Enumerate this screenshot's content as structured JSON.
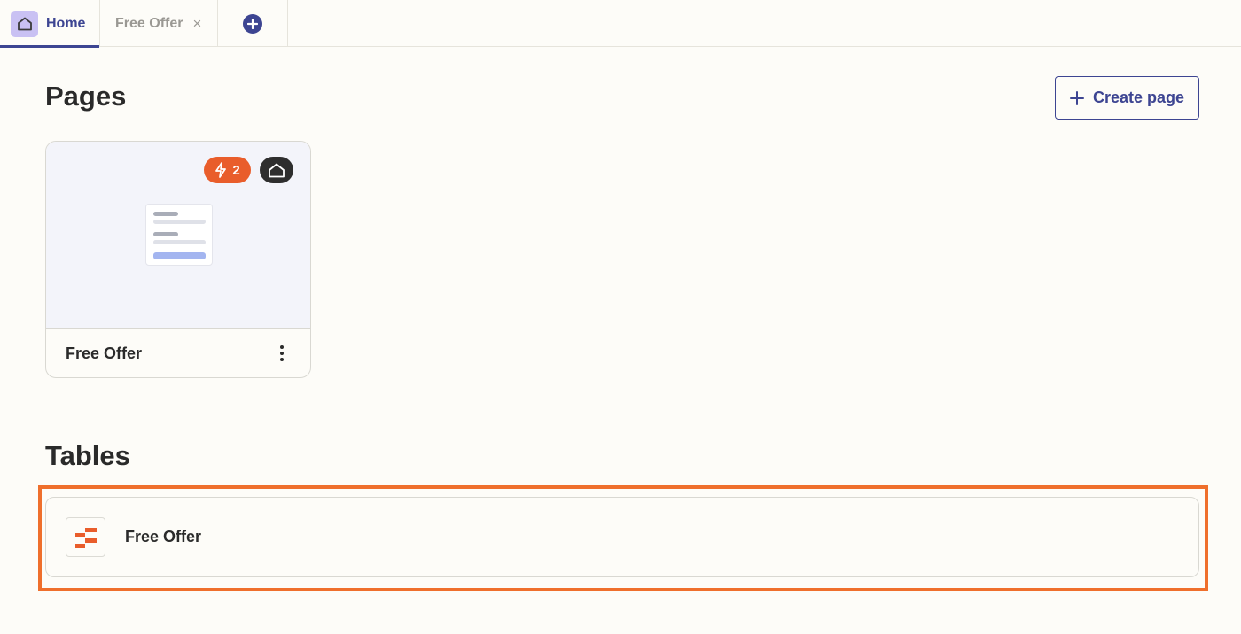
{
  "tabs": {
    "home_label": "Home",
    "free_offer_label": "Free Offer",
    "close_glyph": "×"
  },
  "pages": {
    "title": "Pages",
    "create_button_label": "Create page",
    "cards": [
      {
        "name": "Free Offer",
        "zap_count": "2",
        "icons": [
          "lightning-icon",
          "home-icon",
          "document-thumbnail",
          "kebab-menu-icon"
        ]
      }
    ]
  },
  "tables": {
    "title": "Tables",
    "items": [
      {
        "name": "Free Offer",
        "icon": "table-icon"
      }
    ]
  },
  "colors": {
    "accent": "#3d4592",
    "orange": "#e95d2b",
    "highlight": "#ef6f2c",
    "background": "#fdfcf8"
  }
}
